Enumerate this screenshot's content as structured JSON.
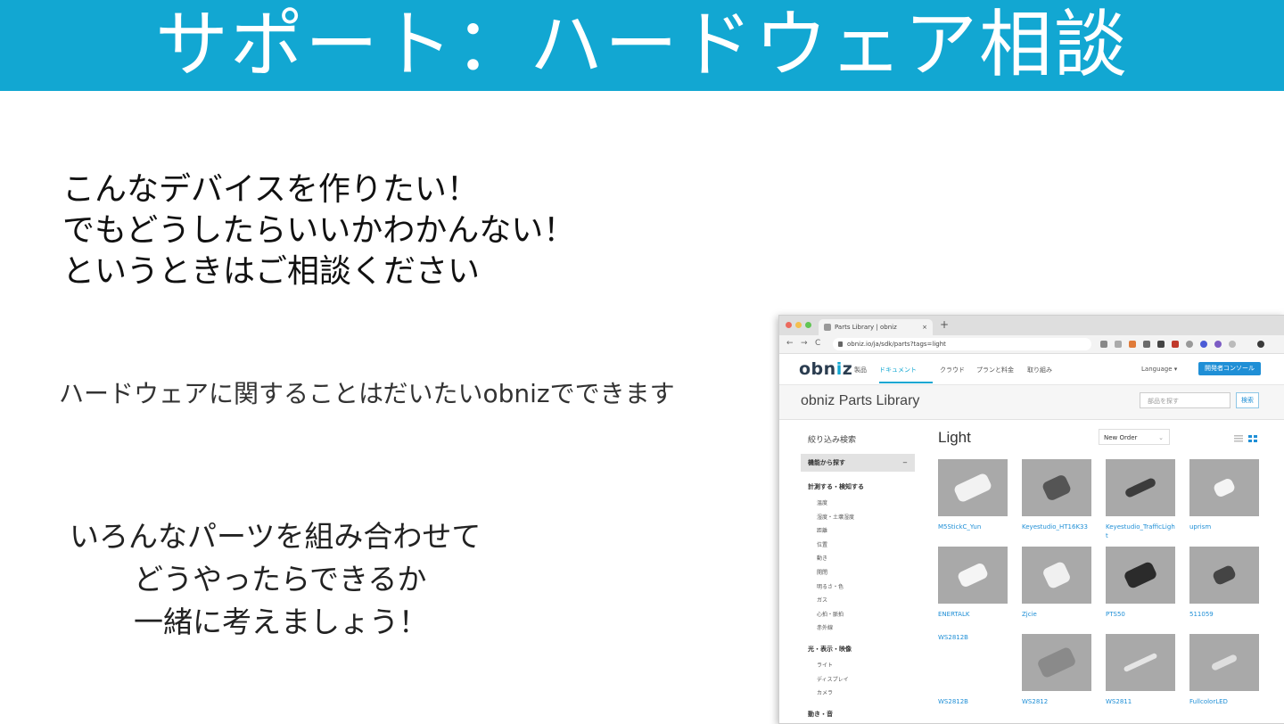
{
  "slide": {
    "title": "サポート：ハードウェア相談",
    "lead": [
      "こんなデバイスを作りたい！",
      "でもどうしたらいいかわかんない！",
      "というときはご相談ください"
    ],
    "sub": "ハードウェアに関することはだいたいobnizでできます",
    "callout": [
      "いろんなパーツを組み合わせて",
      "どうやったらできるか",
      "一緒に考えましょう！"
    ]
  },
  "browser": {
    "tab_title": "Parts Library | obniz",
    "tab_close": "×",
    "new_tab": "+",
    "url": "obniz.io/ja/sdk/parts?tags=light",
    "nav_back": "←",
    "nav_forward": "→",
    "nav_reload": "C"
  },
  "site": {
    "logo_prefix": "obn",
    "logo_i": "i",
    "logo_suffix": "z",
    "nav": [
      "製品",
      "ドキュメント",
      "クラウド",
      "プランと料金",
      "取り組み"
    ],
    "language": "Language ▾",
    "console_button": "開発者コンソール",
    "library_title": "obniz Parts Library",
    "search_placeholder": "部品を探す",
    "search_button": "検索"
  },
  "filters": {
    "title": "絞り込み検索",
    "category_bar": "機能から探す",
    "category_toggle": "−",
    "groups": [
      {
        "label": "計測する・検知する",
        "items": [
          "温度",
          "湿度・土壌湿度",
          "距離",
          "位置",
          "動き",
          "開閉",
          "明るさ・色",
          "ガス",
          "心拍・脈拍",
          "赤外線"
        ]
      },
      {
        "label": "光・表示・映像",
        "items": [
          "ライト",
          "ディスプレイ",
          "カメラ"
        ]
      },
      {
        "label": "動き・音",
        "items": []
      }
    ]
  },
  "results": {
    "section_title": "Light",
    "order": "New Order",
    "order_chevron": "⌄",
    "parts": [
      {
        "name": "M5StickC_Yun"
      },
      {
        "name": "Keyestudio_HT16K33"
      },
      {
        "name": "Keyestudio_TrafficLight"
      },
      {
        "name": "uprism"
      },
      {
        "name": "ENERTALK"
      },
      {
        "name": "Zjcie"
      },
      {
        "name": "PTS50"
      },
      {
        "name": "511059"
      },
      {
        "name": "WS2812B",
        "alt": "WS2812B"
      },
      {
        "name": "WS2812"
      },
      {
        "name": "WS2811"
      },
      {
        "name": "FullcolorLED"
      }
    ]
  },
  "colors": {
    "banner": "#12a7d2",
    "link": "#1f8fd6",
    "thumb": "#a9a9a9"
  }
}
